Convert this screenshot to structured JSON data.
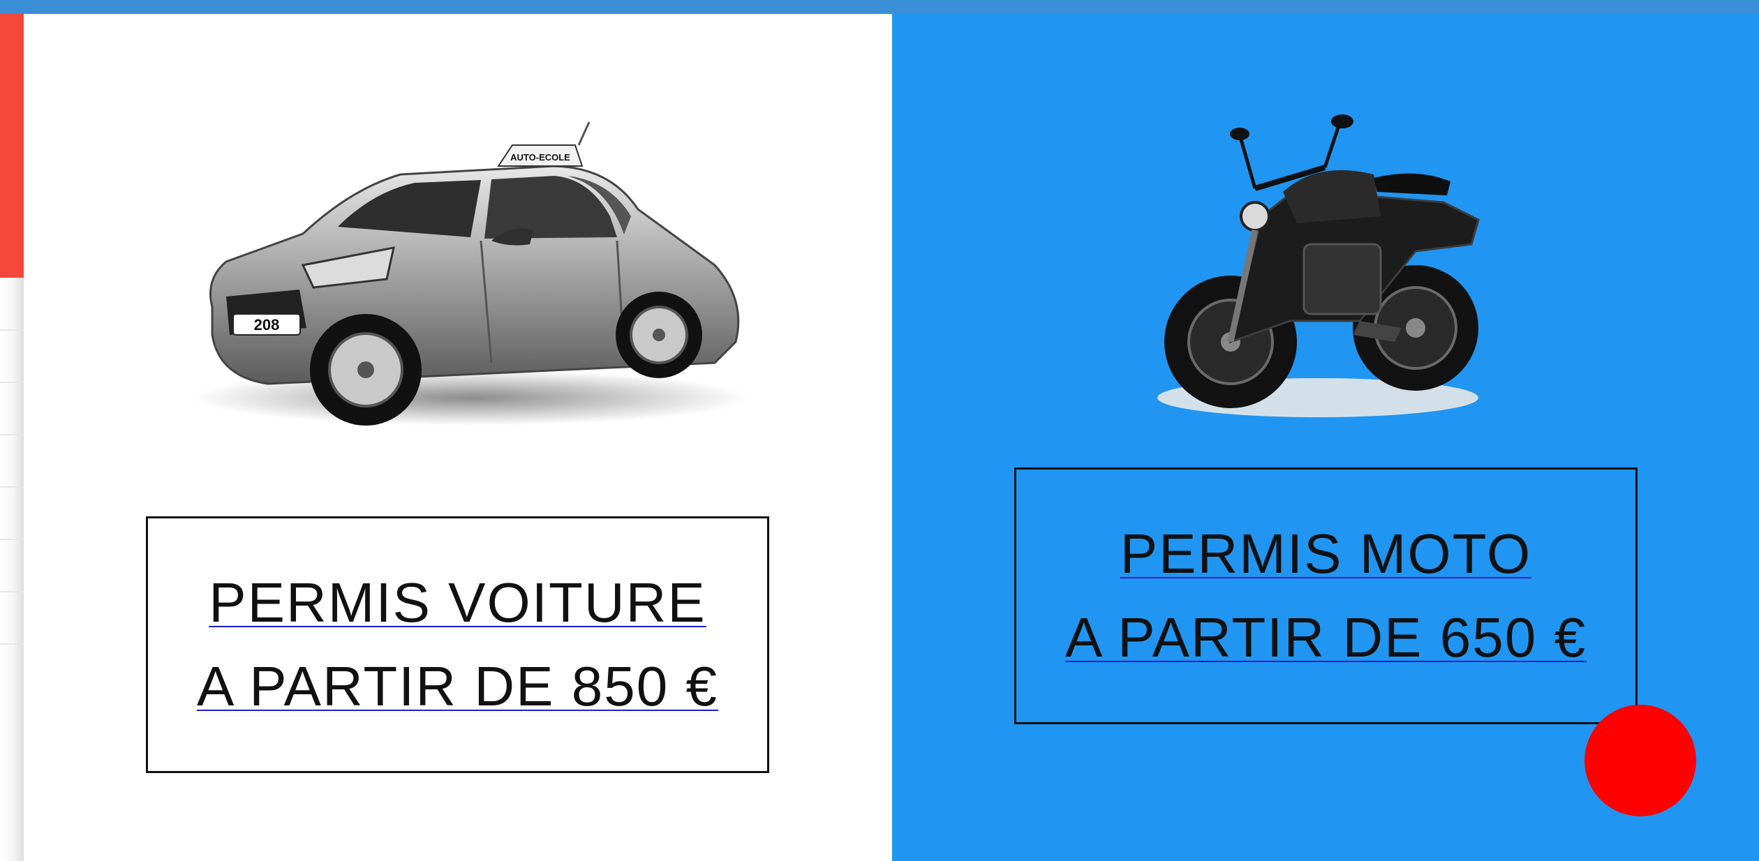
{
  "colors": {
    "top_strip": "#3a8fd6",
    "left_accent": "#f6483a",
    "moto_panel_bg": "#2195f2",
    "fab": "#ff0000",
    "link_underline": "#1b1bd0"
  },
  "car_panel": {
    "image": {
      "icon": "car-image",
      "plate_text": "208",
      "roof_sign_text": "AUTO-ECOLE"
    },
    "cta": {
      "title": "PERMIS VOITURE",
      "price": "A PARTIR DE 850 €"
    }
  },
  "moto_panel": {
    "image": {
      "icon": "motorcycle-image"
    },
    "cta": {
      "title": "PERMIS MOTO",
      "price": "A PARTIR DE 650 €"
    }
  },
  "floating_button": {
    "icon": "red-circle-button"
  }
}
